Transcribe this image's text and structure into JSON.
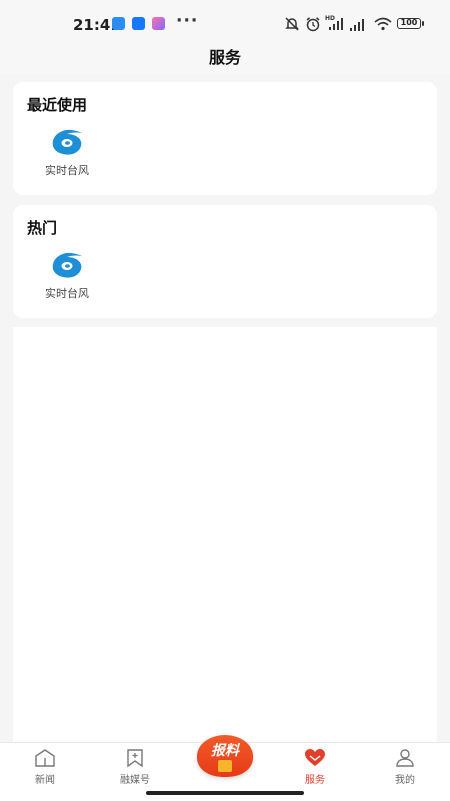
{
  "status_bar": {
    "time": "21:41",
    "more": "···",
    "battery": "100",
    "icons": [
      "message-icon",
      "app-icon",
      "gallery-icon",
      "mute-icon",
      "alarm-icon",
      "signal-hd-icon",
      "signal-icon",
      "wifi-icon",
      "battery-icon"
    ]
  },
  "header": {
    "title": "服务"
  },
  "sections": [
    {
      "title": "最近使用",
      "items": [
        {
          "label": "实时台风",
          "icon": "typhoon-icon"
        }
      ]
    },
    {
      "title": "热门",
      "items": [
        {
          "label": "实时台风",
          "icon": "typhoon-icon"
        }
      ]
    }
  ],
  "bottom_nav": {
    "items": [
      {
        "label": "新闻",
        "icon": "home-icon",
        "active": false
      },
      {
        "label": "融媒号",
        "icon": "bookmark-icon",
        "active": false
      },
      {
        "label": "服务",
        "icon": "heart-icon",
        "active": true
      },
      {
        "label": "我的",
        "icon": "user-icon",
        "active": false
      }
    ],
    "report_label": "报料"
  },
  "colors": {
    "accent": "#e0402c",
    "typhoon_blue": "#1e8fd6",
    "background": "#f5f5f5"
  }
}
